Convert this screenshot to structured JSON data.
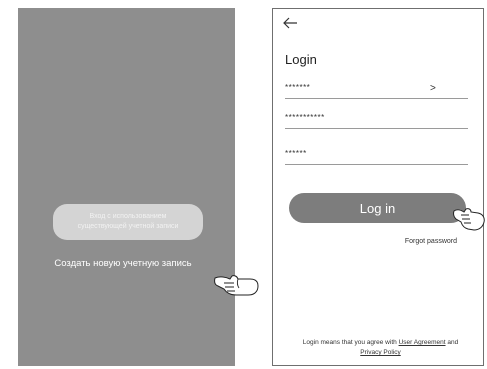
{
  "left_screen": {
    "existing_account_button": {
      "line1": "Вход с использованием",
      "line2": "существующей учетной записи"
    },
    "create_account_label": "Создать новую учетную запись",
    "background_color": "#8e8e8e",
    "button_color": "#d4d4d4"
  },
  "right_screen": {
    "back_icon": "back-arrow-icon",
    "title": "Login",
    "fields": [
      {
        "value": "*******",
        "chevron": ">"
      },
      {
        "value": "***********"
      },
      {
        "value": "******"
      }
    ],
    "login_button": "Log in",
    "login_button_color": "#7d7d7d",
    "forgot_password": "Forgot password",
    "agreement": {
      "prefix": "Login means that you agree with",
      "user_agreement": "User Agreement",
      "and": "and",
      "privacy_policy": "Privacy Policy"
    }
  },
  "icons": {
    "pointer_left": "pointing-hand-icon",
    "pointer_right": "pointing-hand-icon"
  }
}
